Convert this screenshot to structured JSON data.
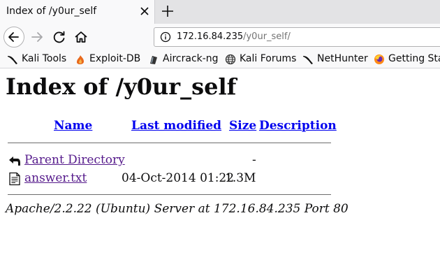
{
  "tab": {
    "title": "Index of /y0ur_self"
  },
  "urlbar": {
    "host": "172.16.84.235",
    "path": "/y0ur_self/"
  },
  "bookmarks": [
    {
      "label": "Kali Tools",
      "icon": "kali-dragon-icon"
    },
    {
      "label": "Exploit-DB",
      "icon": "exploit-db-icon"
    },
    {
      "label": "Aircrack-ng",
      "icon": "aircrack-icon"
    },
    {
      "label": "Kali Forums",
      "icon": "globe-icon"
    },
    {
      "label": "NetHunter",
      "icon": "kali-dragon-icon"
    },
    {
      "label": "Getting Sta",
      "icon": "firefox-icon"
    }
  ],
  "page": {
    "heading": "Index of /y0ur_self",
    "columns": {
      "name": "Name",
      "last_modified": "Last modified",
      "size": "Size",
      "description": "Description"
    },
    "rows": [
      {
        "name": "Parent Directory",
        "modified": "",
        "size": "-",
        "icon": "back-arrow-icon"
      },
      {
        "name": "answer.txt",
        "modified": "04-Oct-2014 01:22",
        "size": "1.3M",
        "icon": "text-file-icon"
      }
    ],
    "address": "Apache/2.2.22 (Ubuntu) Server at 172.16.84.235 Port 80"
  }
}
